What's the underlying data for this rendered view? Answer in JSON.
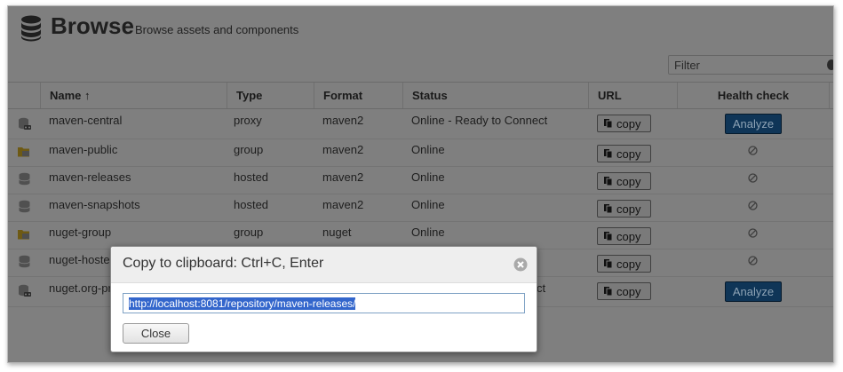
{
  "header": {
    "title": "Browse",
    "subtitle": "Browse assets and components",
    "filter_placeholder": "Filter"
  },
  "table": {
    "columns": {
      "name": "Name",
      "sort_indicator": "↑",
      "type": "Type",
      "format": "Format",
      "status": "Status",
      "url": "URL",
      "health": "Health check"
    },
    "copy_label": "copy",
    "analyze_label": "Analyze",
    "rows": [
      {
        "name": "maven-central",
        "type": "proxy",
        "format": "maven2",
        "status": "Online - Ready to Connect",
        "icon": "proxy-repo-icon",
        "health": "analyze"
      },
      {
        "name": "maven-public",
        "type": "group",
        "format": "maven2",
        "status": "Online",
        "icon": "group-repo-icon",
        "health": "na"
      },
      {
        "name": "maven-releases",
        "type": "hosted",
        "format": "maven2",
        "status": "Online",
        "icon": "hosted-repo-icon",
        "health": "na"
      },
      {
        "name": "maven-snapshots",
        "type": "hosted",
        "format": "maven2",
        "status": "Online",
        "icon": "hosted-repo-icon",
        "health": "na"
      },
      {
        "name": "nuget-group",
        "type": "group",
        "format": "nuget",
        "status": "Online",
        "icon": "group-repo-icon",
        "health": "na"
      },
      {
        "name": "nuget-hoste",
        "type": "",
        "format": "",
        "status": "",
        "icon": "hosted-repo-icon",
        "health": "na"
      },
      {
        "name": "nuget.org-pr",
        "type": "",
        "format": "",
        "status": "ct",
        "icon": "proxy-repo-icon",
        "health": "analyze"
      }
    ]
  },
  "modal": {
    "title": "Copy to clipboard: Ctrl+C, Enter",
    "url": "http://localhost:8081/repository/maven-releases/",
    "close_label": "Close"
  },
  "colors": {
    "overlay": "#7f7f7f",
    "analyze_bg": "#0f3557",
    "selection": "#3366cc",
    "modal_bg": "#ffffff"
  }
}
